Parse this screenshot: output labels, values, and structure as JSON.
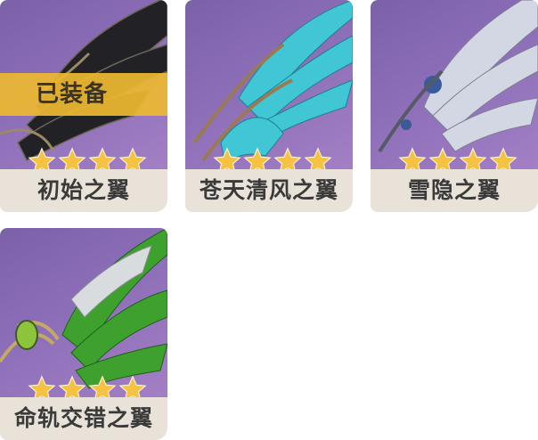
{
  "items": [
    {
      "name": "初始之翼",
      "rarity": 4,
      "equipped": true,
      "equipped_label": "已装备",
      "wing_color": "#2a2a2e",
      "accent": "#8a7658"
    },
    {
      "name": "苍天清风之翼",
      "rarity": 4,
      "equipped": false,
      "wing_color": "#3fc7d6",
      "accent": "#8d6b48"
    },
    {
      "name": "雪隐之翼",
      "rarity": 4,
      "equipped": false,
      "wing_color": "#c9d0de",
      "accent": "#3b5a9a"
    },
    {
      "name": "命轨交错之翼",
      "rarity": 4,
      "equipped": false,
      "wing_color": "#3fa630",
      "accent": "#c5a866"
    }
  ],
  "colors": {
    "card_bg": "#e8e2d8",
    "art_bg": "#8c6eb8",
    "star": "#f5c242",
    "equipped_bar": "#ecb832"
  }
}
